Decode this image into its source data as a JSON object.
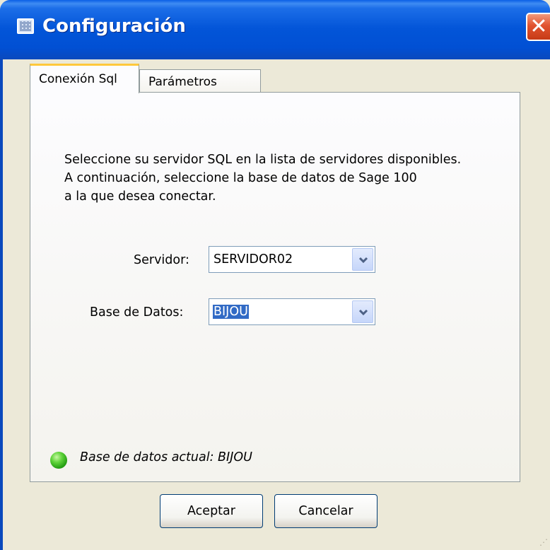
{
  "window": {
    "title": "Configuración",
    "close_label": "✕"
  },
  "tabs": [
    {
      "label": "Conexión Sql",
      "active": true
    },
    {
      "label": "Parámetros",
      "active": false
    }
  ],
  "instructions": [
    "Seleccione su servidor SQL en la lista de servidores disponibles.",
    "A continuación, seleccione la base de datos de Sage 100",
    "a la que desea conectar."
  ],
  "server": {
    "label": "Servidor:",
    "value": "SERVIDOR02"
  },
  "database": {
    "label": "Base de Datos:",
    "value": "BIJOU"
  },
  "status": {
    "text": "Base de datos actual: BIJOU",
    "color": "#3cc41e"
  },
  "buttons": {
    "ok": "Aceptar",
    "cancel": "Cancelar"
  }
}
